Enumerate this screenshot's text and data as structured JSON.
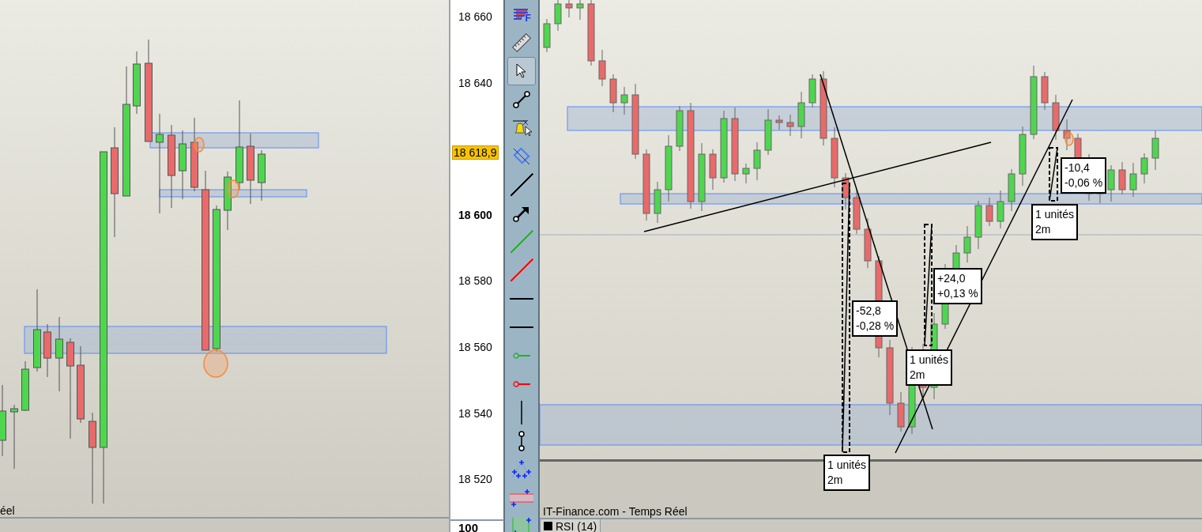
{
  "left_chart": {
    "footer": "éel"
  },
  "price_axis": {
    "ticks": [
      {
        "label": "18 660",
        "strong": false
      },
      {
        "label": "18 640",
        "strong": false
      },
      {
        "label": "18 600",
        "strong": true
      },
      {
        "label": "18 580",
        "strong": false
      },
      {
        "label": "18 560",
        "strong": false
      },
      {
        "label": "18 540",
        "strong": false
      },
      {
        "label": "18 520",
        "strong": false
      }
    ],
    "current_price": "18 618,9",
    "rsi_tick": "100"
  },
  "toolbar": {
    "tools": [
      {
        "kind": "panel",
        "label": "F",
        "selected": false
      },
      {
        "kind": "ruler",
        "selected": false
      },
      {
        "kind": "pointer",
        "selected": true
      },
      {
        "kind": "segment",
        "selected": false
      },
      {
        "kind": "alert",
        "selected": false
      },
      {
        "kind": "rectangle",
        "selected": false
      },
      {
        "kind": "line",
        "color": "#000000",
        "selected": false
      },
      {
        "kind": "arrow",
        "selected": false
      },
      {
        "kind": "line",
        "color": "#22b322",
        "selected": false
      },
      {
        "kind": "line",
        "color": "#ff0000",
        "selected": false
      },
      {
        "kind": "hline",
        "color": "#000000",
        "selected": false
      },
      {
        "kind": "hline",
        "color": "#000000",
        "selected": false
      },
      {
        "kind": "hray",
        "color": "#22b322",
        "selected": false
      },
      {
        "kind": "hray",
        "color": "#ff0000",
        "selected": false
      },
      {
        "kind": "vline",
        "selected": false
      },
      {
        "kind": "vsegment",
        "selected": false
      },
      {
        "kind": "fan",
        "selected": false
      },
      {
        "kind": "channel",
        "selected": false
      },
      {
        "kind": "band",
        "selected": false
      }
    ]
  },
  "right_chart": {
    "measurements": [
      {
        "value": "-52,8",
        "percent": "-0,28 %",
        "units": "1 unités",
        "period": "2m"
      },
      {
        "value": "+24,0",
        "percent": "+0,13 %",
        "units": "1 unités",
        "period": "2m"
      },
      {
        "value": "-10,4",
        "percent": "-0,06 %",
        "units": "1 unités",
        "period": "2m"
      }
    ],
    "source": "IT-Finance.com - Temps Réel"
  },
  "indicator_tab": {
    "label": "RSI (14)"
  }
}
